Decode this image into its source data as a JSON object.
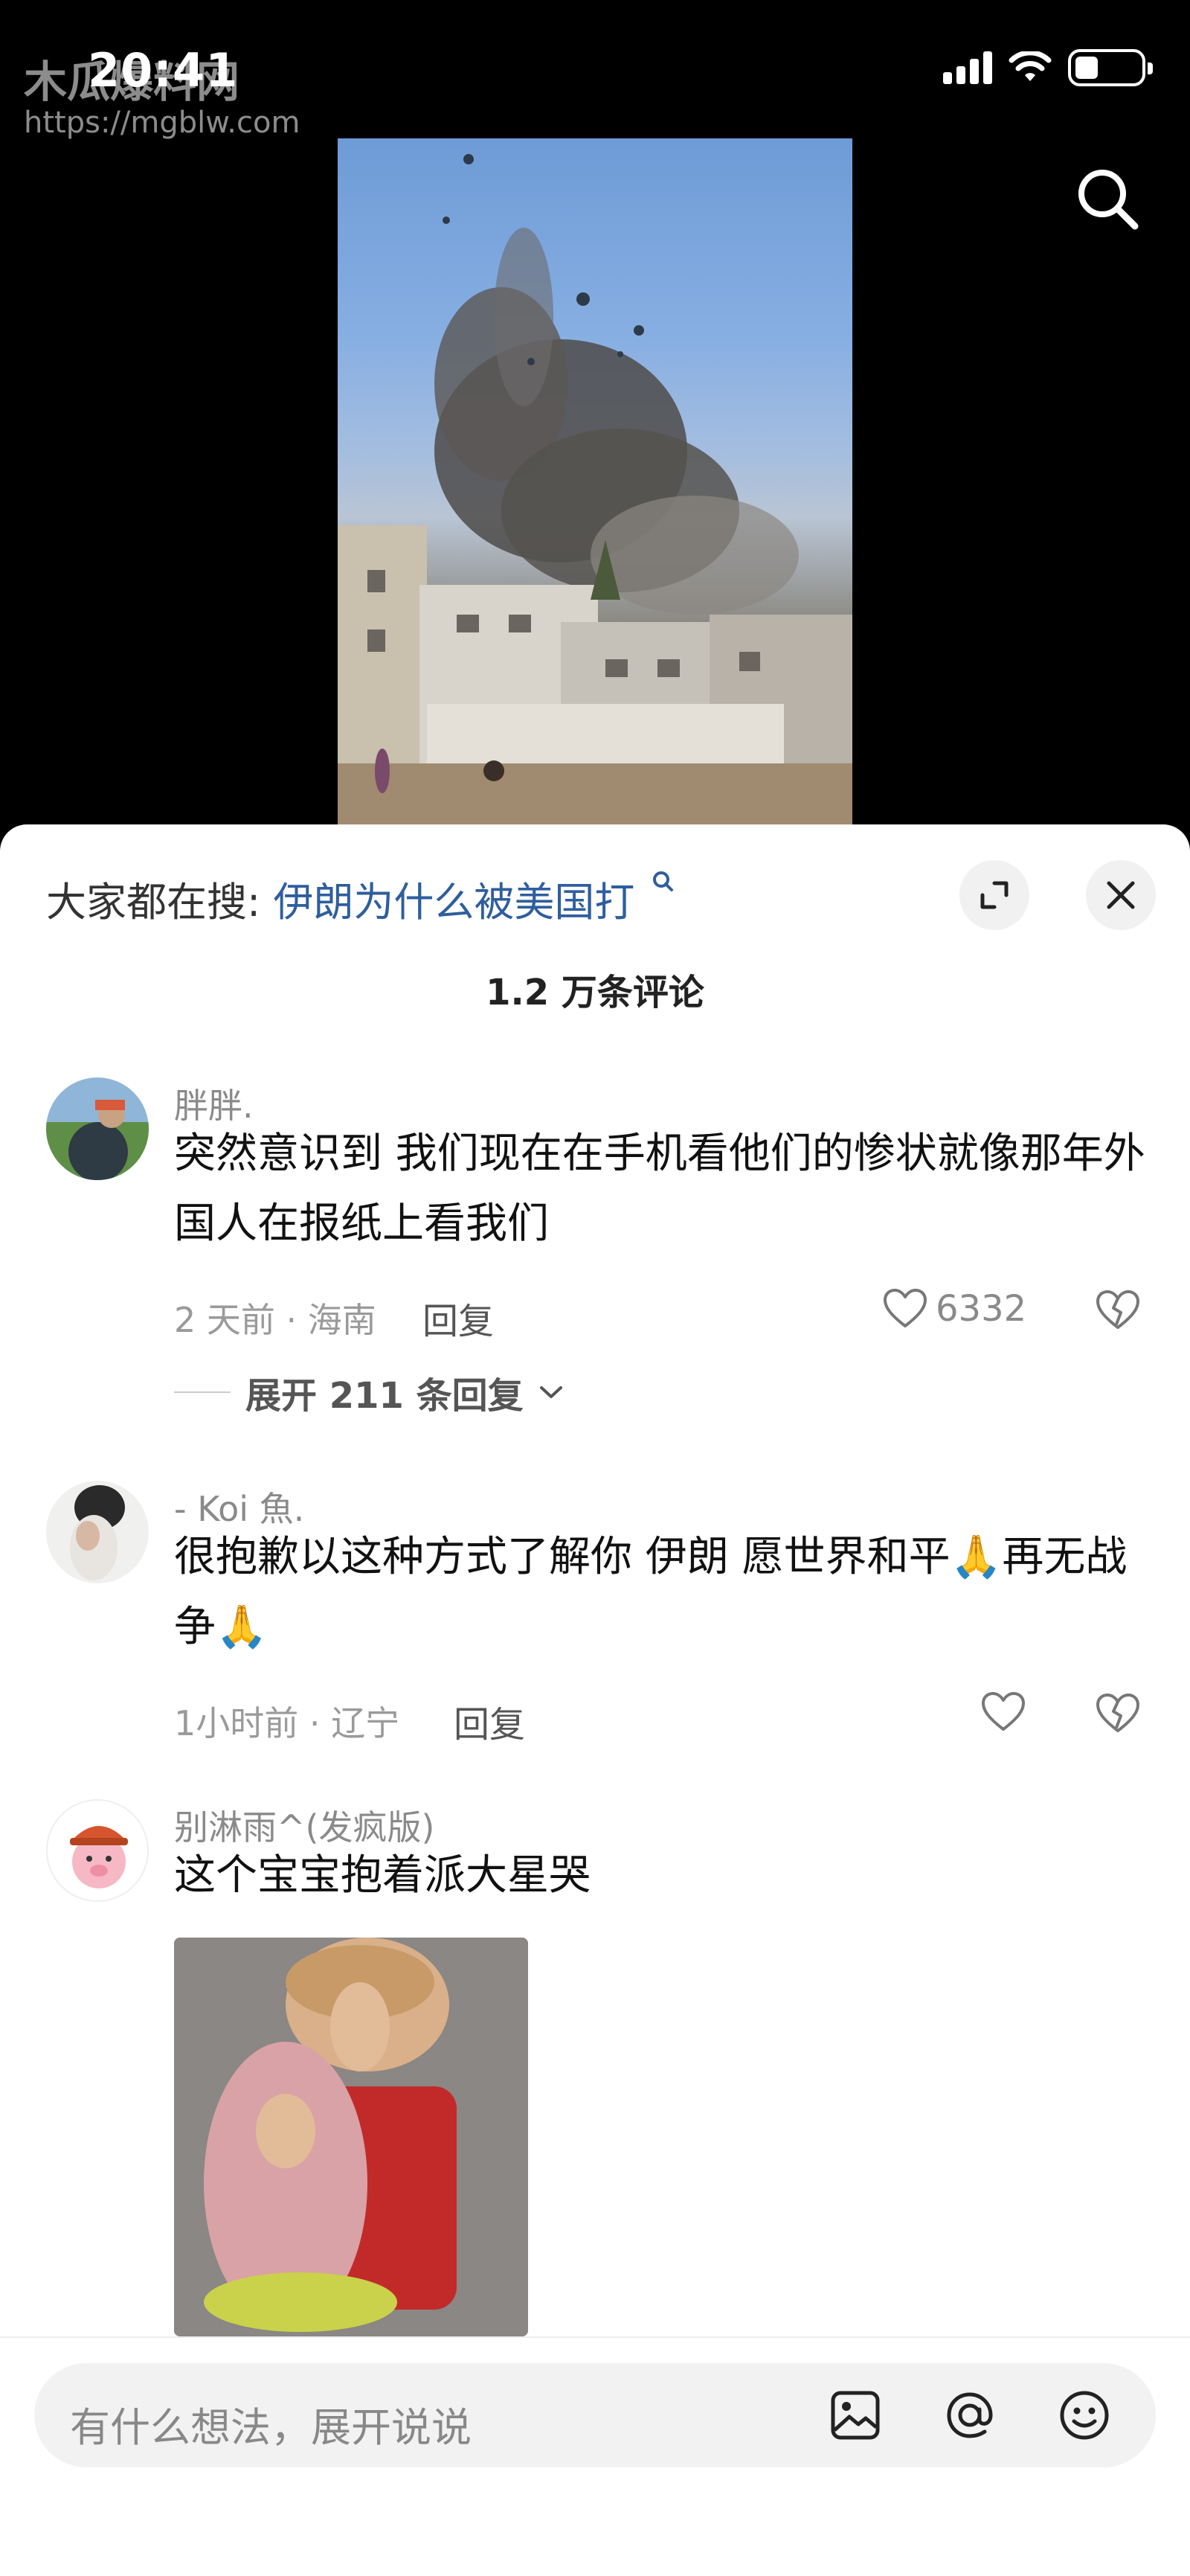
{
  "status_bar": {
    "time": "20:41"
  },
  "watermark": {
    "name": "木瓜爆料网",
    "url": "https://mgblw.com"
  },
  "header": {
    "search_icon": "search-icon"
  },
  "sheet": {
    "hot_search_label": "大家都在搜:",
    "hot_search_keyword": "伊朗为什么被美国打",
    "comment_count": "1.2 万条评论",
    "buttons": {
      "expand_icon": "expand-icon",
      "close_icon": "close-icon"
    }
  },
  "comments": [
    {
      "user": "胖胖.",
      "text": "突然意识到  我们现在在手机看他们的惨状就像那年外国人在报纸上看我们",
      "time_location": "2 天前 · 海南",
      "reply_label": "回复",
      "likes": "6332",
      "expand_replies": "展开 211 条回复"
    },
    {
      "user": "- Koi 魚.",
      "text_before_emoji": "很抱歉以这种方式了解你  伊朗  愿世界和平",
      "emoji_1": "🙏",
      "text_after_emoji": "再无战争",
      "emoji_2": "🙏",
      "time_location": "1小时前 · 辽宁",
      "reply_label": "回复"
    },
    {
      "user": "别淋雨^(发疯版)",
      "text": "这个宝宝抱着派大星哭"
    }
  ],
  "input_bar": {
    "placeholder": "有什么想法，展开说说",
    "icons": [
      "image-icon",
      "at-icon",
      "emoji-icon"
    ]
  }
}
